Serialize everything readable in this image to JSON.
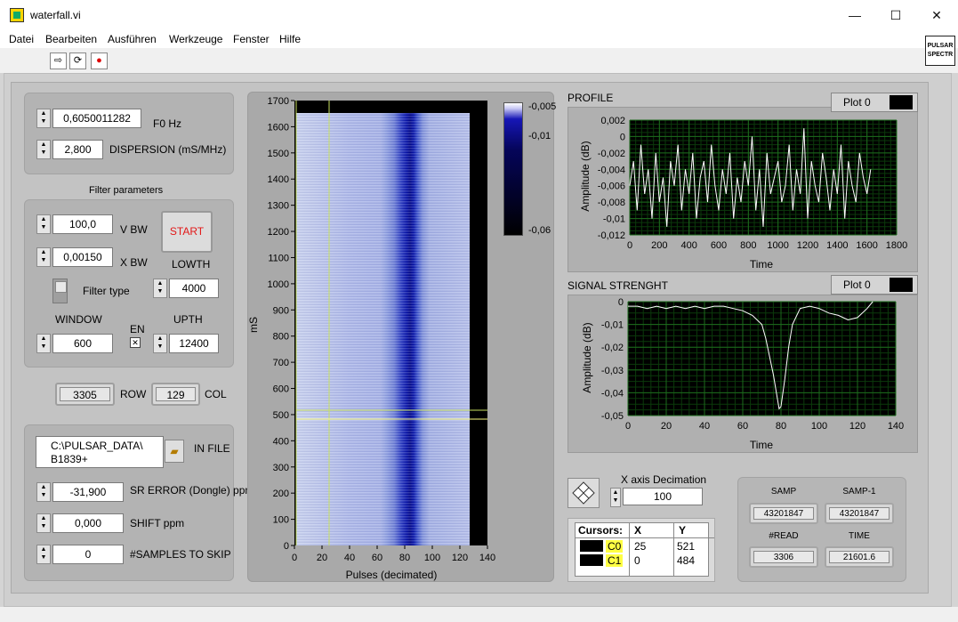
{
  "window": {
    "title": "waterfall.vi",
    "minimize": "—",
    "maximize": "☐",
    "close": "✕"
  },
  "menu": [
    "Datei",
    "Bearbeiten",
    "Ausführen",
    "Werkzeuge",
    "Fenster",
    "Hilfe"
  ],
  "toolbar": {
    "run": "⇨",
    "run_continuous": "⟳",
    "abort": "●"
  },
  "vi_icon": {
    "line1": "PULSAR",
    "line2": "SPECTR"
  },
  "controls": {
    "f0": {
      "value": "0,6050011282",
      "label": "F0 Hz"
    },
    "dispersion": {
      "value": "2,800",
      "label": "DISPERSION (mS/MHz)"
    },
    "filter_title": "Filter parameters",
    "vbw": {
      "value": "100,0",
      "label": "V BW"
    },
    "xbw": {
      "value": "0,00150",
      "label": "X BW"
    },
    "start_label": "START",
    "lowth": {
      "value": "4000",
      "label": "LOWTH"
    },
    "filter_type_label": "Filter type",
    "window": {
      "value": "600",
      "label": "WINDOW"
    },
    "en_label": "EN",
    "upth": {
      "value": "12400",
      "label": "UPTH"
    },
    "row": {
      "value": "3305",
      "label": "ROW"
    },
    "col": {
      "value": "129",
      "label": "COL"
    },
    "in_file": {
      "line1": "C:\\PULSAR_DATA\\",
      "line2": "B1839+",
      "label": "IN FILE"
    },
    "sr_error": {
      "value": "-31,900",
      "label": "SR ERROR (Dongle) ppm"
    },
    "shift": {
      "value": "0,000",
      "label": "SHIFT ppm"
    },
    "skip": {
      "value": "0",
      "label": "#SAMPLES TO SKIP"
    }
  },
  "waterfall": {
    "ylabel": "mS",
    "xlabel": "Pulses (decimated)",
    "y_ticks": [
      "1700",
      "1600",
      "1500",
      "1400",
      "1300",
      "1200",
      "1100",
      "1000",
      "900",
      "800",
      "700",
      "600",
      "500",
      "400",
      "300",
      "200",
      "100",
      "0"
    ],
    "x_ticks": [
      "0",
      "20",
      "40",
      "60",
      "80",
      "100",
      "120",
      "140"
    ],
    "colorbar_ticks": [
      "-0,005",
      "-0,01",
      "-0,06"
    ]
  },
  "profile": {
    "title": "PROFILE",
    "legend": "Plot 0",
    "ylabel": "Amplitude (dB)",
    "xlabel": "Time",
    "y_ticks": [
      "0,002",
      "0",
      "-0,002",
      "-0,004",
      "-0,006",
      "-0,008",
      "-0,01",
      "-0,012"
    ],
    "x_ticks": [
      "0",
      "200",
      "400",
      "600",
      "800",
      "1000",
      "1200",
      "1400",
      "1600",
      "1800"
    ]
  },
  "signal": {
    "title": "SIGNAL STRENGHT",
    "legend": "Plot 0",
    "ylabel": "Amplitude (dB)",
    "xlabel": "Time",
    "y_ticks": [
      "0",
      "-0,01",
      "-0,02",
      "-0,03",
      "-0,04",
      "-0,05"
    ],
    "x_ticks": [
      "0",
      "20",
      "40",
      "60",
      "80",
      "100",
      "120",
      "140"
    ]
  },
  "decimation": {
    "label": "X axis Decimation",
    "value": "100"
  },
  "cursors": {
    "header": [
      "Cursors:",
      "X",
      "Y"
    ],
    "rows": [
      {
        "name": "C0",
        "x": "25",
        "y": "521"
      },
      {
        "name": "C1",
        "x": "0",
        "y": "484"
      }
    ]
  },
  "stats": {
    "samp": {
      "label": "SAMP",
      "value": "43201847"
    },
    "samp1": {
      "label": "SAMP-1",
      "value": "43201847"
    },
    "read": {
      "label": "#READ",
      "value": "3306"
    },
    "time": {
      "label": "TIME",
      "value": "21601.6"
    }
  },
  "chart_data": [
    {
      "type": "heatmap",
      "title": "",
      "xlabel": "Pulses (decimated)",
      "ylabel": "mS",
      "xlim": [
        0,
        140
      ],
      "ylim": [
        0,
        1700
      ],
      "colorbar": [
        -0.005,
        -0.01,
        -0.06
      ],
      "cursors": [
        {
          "name": "C0",
          "x": 25,
          "y": 521
        },
        {
          "name": "C1",
          "x": 0,
          "y": 484
        }
      ]
    },
    {
      "type": "line",
      "title": "PROFILE",
      "xlabel": "Time",
      "ylabel": "Amplitude (dB)",
      "xlim": [
        0,
        1800
      ],
      "ylim": [
        -0.012,
        0.002
      ],
      "grid": true,
      "series": [
        {
          "name": "Plot 0",
          "x_start": 0,
          "x_step": 25,
          "values": [
            -0.006,
            -0.003,
            -0.009,
            -0.001,
            -0.007,
            -0.004,
            -0.01,
            -0.002,
            -0.008,
            -0.005,
            -0.011,
            -0.003,
            -0.006,
            -0.001,
            -0.009,
            -0.004,
            -0.007,
            -0.002,
            -0.01,
            -0.005,
            -0.003,
            -0.008,
            -0.001,
            -0.006,
            -0.009,
            -0.004,
            -0.007,
            -0.002,
            -0.01,
            -0.005,
            -0.008,
            -0.003,
            -0.006,
            0.0,
            -0.009,
            -0.004,
            -0.011,
            -0.002,
            -0.007,
            -0.005,
            -0.003,
            -0.008,
            -0.006,
            -0.001,
            -0.009,
            -0.004,
            -0.007,
            0.001,
            -0.01,
            -0.003,
            -0.006,
            -0.008,
            -0.002,
            -0.005,
            -0.009,
            -0.004,
            -0.007,
            -0.001,
            -0.01,
            -0.003,
            -0.006,
            -0.008,
            -0.002,
            -0.005,
            -0.007,
            -0.004
          ]
        }
      ]
    },
    {
      "type": "line",
      "title": "SIGNAL STRENGHT",
      "xlabel": "Time",
      "ylabel": "Amplitude (dB)",
      "xlim": [
        0,
        140
      ],
      "ylim": [
        -0.05,
        0
      ],
      "grid": true,
      "series": [
        {
          "name": "Plot 0",
          "x": [
            0,
            5,
            10,
            15,
            20,
            25,
            30,
            35,
            40,
            45,
            50,
            55,
            60,
            65,
            70,
            72,
            74,
            76,
            78,
            79,
            80,
            82,
            84,
            86,
            90,
            95,
            100,
            105,
            110,
            115,
            120,
            125,
            128
          ],
          "values": [
            -0.002,
            -0.002,
            -0.003,
            -0.002,
            -0.003,
            -0.002,
            -0.003,
            -0.002,
            -0.003,
            -0.002,
            -0.002,
            -0.003,
            -0.004,
            -0.006,
            -0.01,
            -0.016,
            -0.024,
            -0.032,
            -0.042,
            -0.047,
            -0.046,
            -0.034,
            -0.02,
            -0.01,
            -0.003,
            -0.002,
            -0.003,
            -0.005,
            -0.006,
            -0.008,
            -0.007,
            -0.003,
            0.0
          ]
        }
      ]
    }
  ]
}
